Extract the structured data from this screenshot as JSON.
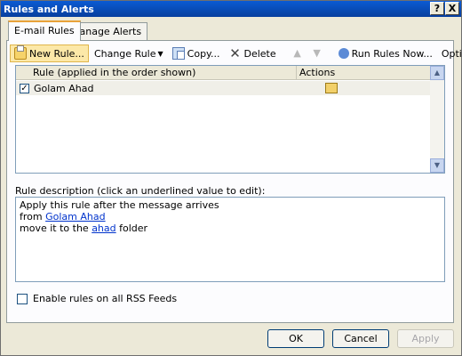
{
  "window": {
    "title": "Rules and Alerts",
    "help": "?",
    "close": "X"
  },
  "tabs": [
    {
      "label": "E-mail Rules",
      "active": true
    },
    {
      "label": "Manage Alerts",
      "active": false
    }
  ],
  "toolbar": {
    "new_rule": "New Rule...",
    "change_rule": "Change Rule",
    "copy": "Copy...",
    "delete": "Delete",
    "run_rules": "Run Rules Now...",
    "options": "Options"
  },
  "rules_table": {
    "columns": [
      "Rule (applied in the order shown)",
      "Actions"
    ],
    "rows": [
      {
        "name": "Golam Ahad",
        "checked": true
      }
    ]
  },
  "description": {
    "label": "Rule description (click an underlined value to edit):",
    "line1": "Apply this rule after the message arrives",
    "line2_prefix": "from ",
    "line2_link": "Golam Ahad",
    "line3_prefix": "move it to the ",
    "line3_link": "ahad",
    "line3_suffix": " folder"
  },
  "rss": {
    "label": "Enable rules on all RSS Feeds",
    "checked": false
  },
  "buttons": {
    "ok": "OK",
    "cancel": "Cancel",
    "apply": "Apply"
  }
}
